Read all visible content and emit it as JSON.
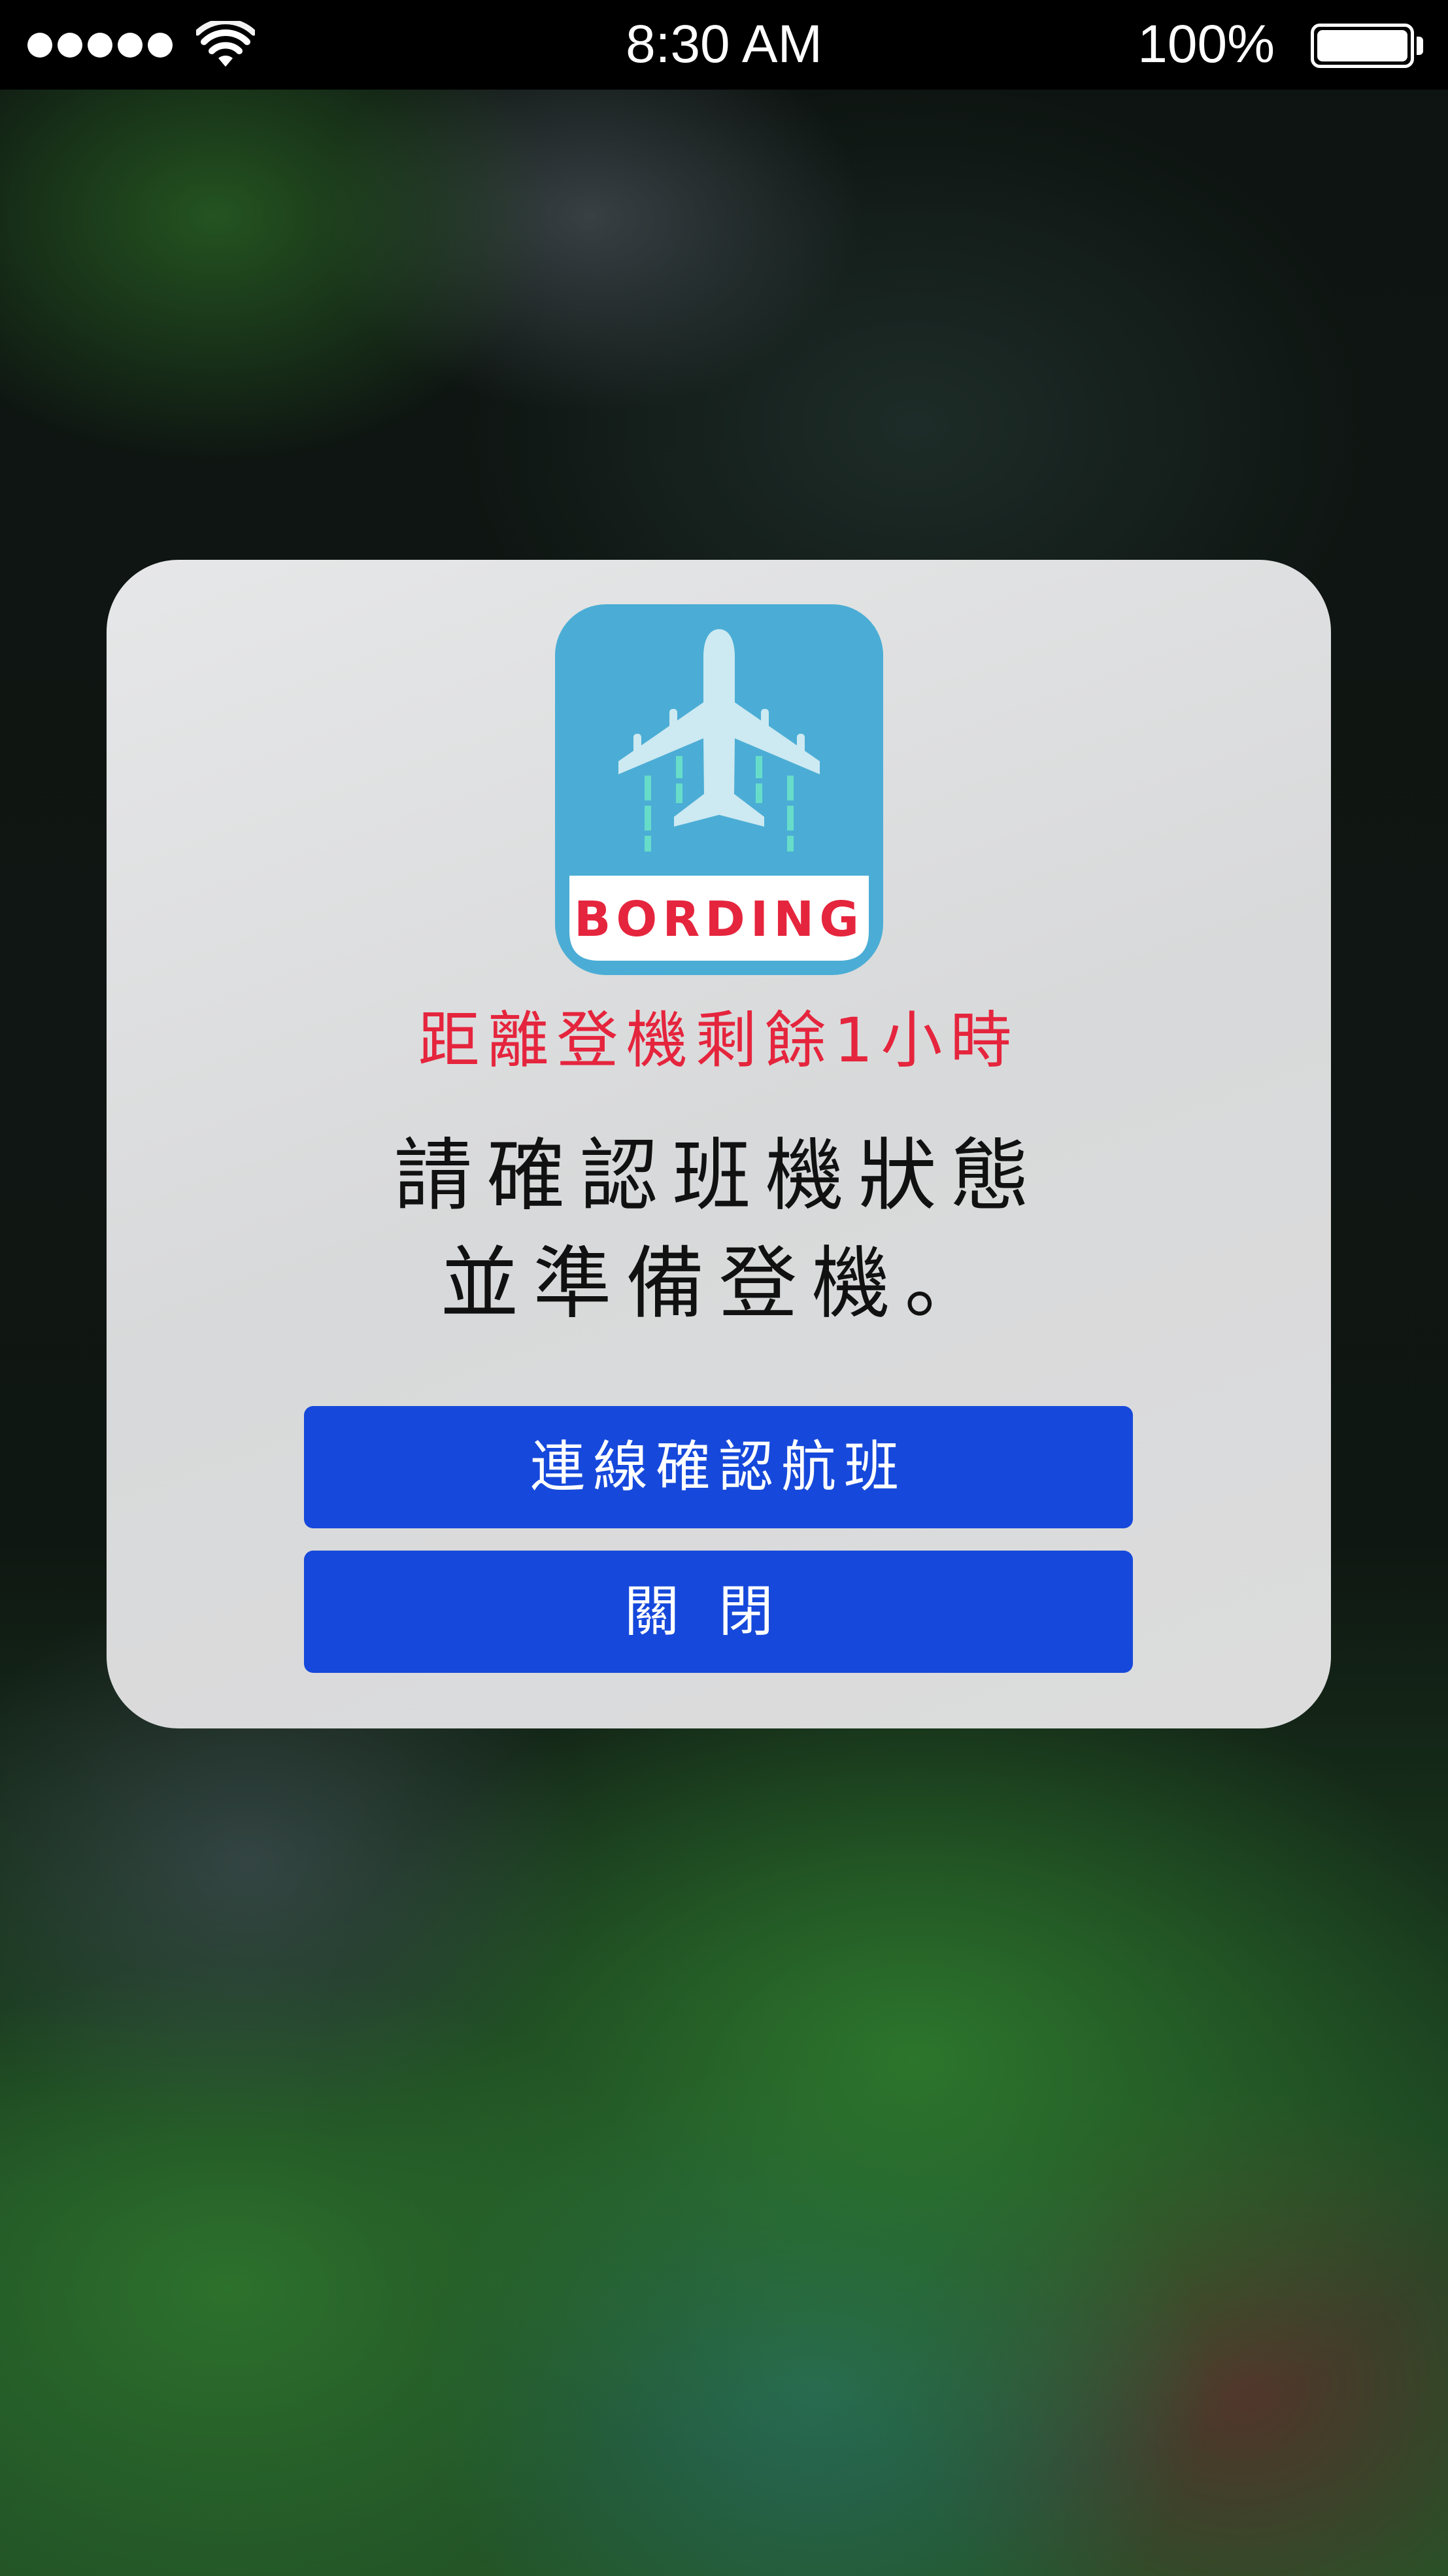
{
  "status_bar": {
    "time": "8:30 AM",
    "battery": "100%",
    "signal_bars": 5,
    "battery_level": 1.0
  },
  "dialog": {
    "app_icon": {
      "label": "BORDING",
      "icon": "airplane-icon",
      "colors": {
        "background": "#4badd5",
        "plane": "#cde9f1",
        "trails": "#67ddc9",
        "label": "#e5253d"
      }
    },
    "countdown": "距離登機剩餘1小時",
    "message_line1": "請確認班機狀態",
    "message_line2": "並準備登機。",
    "buttons": {
      "confirm": "連線確認航班",
      "close": "關閉"
    }
  },
  "colors": {
    "accent_button": "#1649db",
    "warning_text": "#e5253d",
    "status_bar_bg": "#000000"
  }
}
